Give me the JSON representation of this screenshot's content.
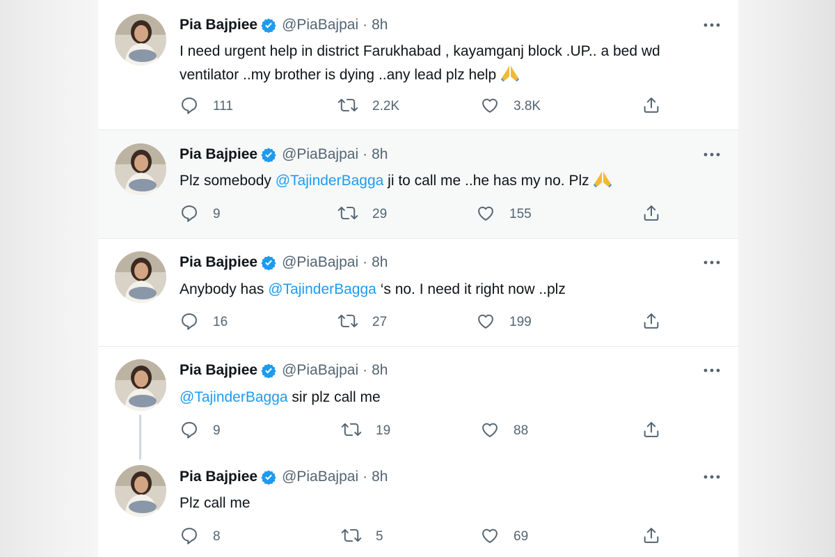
{
  "tweets": [
    {
      "name": "Pia Bajpiee",
      "handle": "@PiaBajpai",
      "separator": "·",
      "time": "8h",
      "text_parts": [
        "I need urgent help in district Farukhabad , kayamganj block .UP.. a bed wd ventilator ..my brother is dying ..any lead plz help"
      ],
      "replies": "111",
      "retweets": "2.2K",
      "likes": "3.8K"
    },
    {
      "name": "Pia Bajpiee",
      "handle": "@PiaBajpai",
      "separator": "·",
      "time": "8h",
      "text_parts": [
        "Plz somebody ",
        "@TajinderBagga",
        " ji to call me ..he has my no. Plz"
      ],
      "replies": "9",
      "retweets": "29",
      "likes": "155"
    },
    {
      "name": "Pia Bajpiee",
      "handle": "@PiaBajpai",
      "separator": "·",
      "time": "8h",
      "text_parts": [
        "Anybody has ",
        "@TajinderBagga",
        " ‘s no. I need it right now ..plz"
      ],
      "replies": "16",
      "retweets": "27",
      "likes": "199"
    },
    {
      "name": "Pia Bajpiee",
      "handle": "@PiaBajpai",
      "separator": "·",
      "time": "8h",
      "text_parts": [
        "@TajinderBagga",
        " sir plz call me"
      ],
      "replies": "9",
      "retweets": "19",
      "likes": "88"
    },
    {
      "name": "Pia Bajpiee",
      "handle": "@PiaBajpai",
      "separator": "·",
      "time": "8h",
      "text_parts": [
        "Plz call me"
      ],
      "replies": "8",
      "retweets": "5",
      "likes": "69"
    }
  ],
  "colors": {
    "accent": "#1d9bf0",
    "text": "#0f1419",
    "muted": "#536471",
    "divider": "#e6ecf0",
    "verified": "#1d9bf0"
  },
  "icons": [
    "verified-badge-icon",
    "more-icon",
    "reply-icon",
    "retweet-icon",
    "like-icon",
    "share-icon",
    "folded-hands-emoji"
  ]
}
